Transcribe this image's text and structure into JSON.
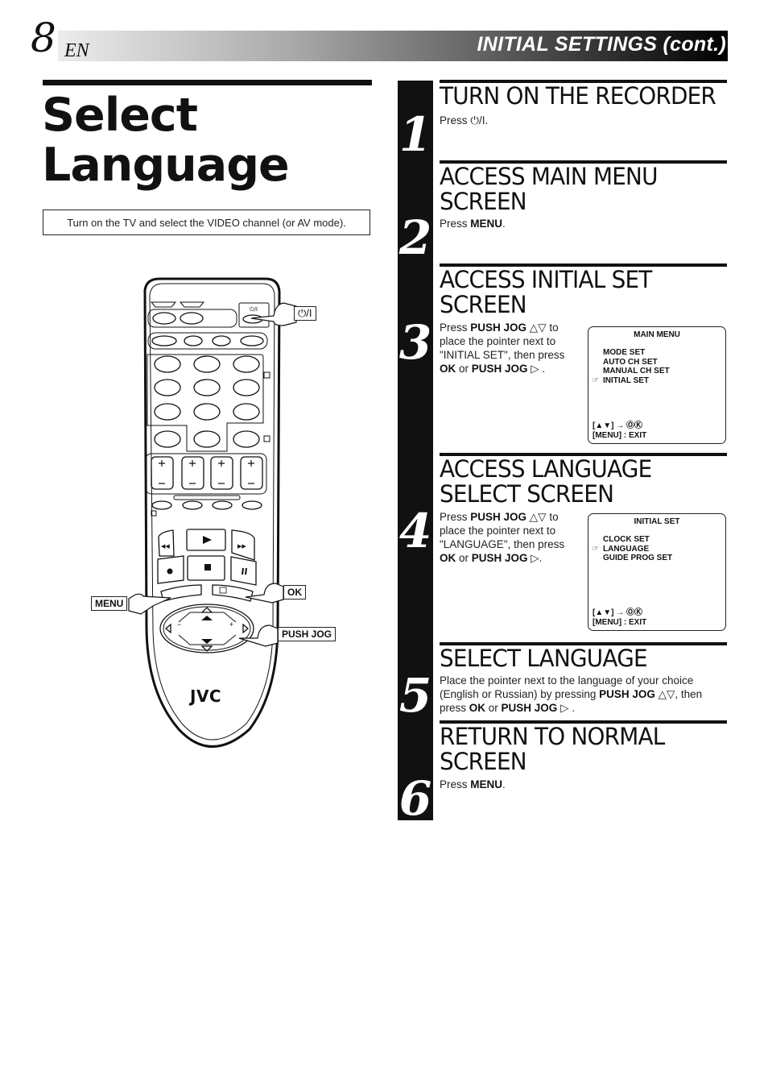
{
  "header": {
    "page_number": "8",
    "language_code": "EN",
    "section_title": "INITIAL SETTINGS (cont.)"
  },
  "page_title": {
    "line1": "Select",
    "line2": "Language"
  },
  "note": "Turn on the TV and select the VIDEO channel (or AV mode).",
  "remote": {
    "brand": "JVC",
    "callouts": {
      "power": "⏻/I",
      "menu": "MENU",
      "ok": "OK",
      "push_jog": "PUSH JOG"
    }
  },
  "steps": [
    {
      "number": "1",
      "heading": "TURN ON THE RECORDER",
      "body_prefix": "Press ",
      "body_symbol": "⏻/I",
      "body_suffix": "."
    },
    {
      "number": "2",
      "heading_line1": "ACCESS MAIN MENU",
      "heading_line2": "SCREEN",
      "body_prefix": "Press ",
      "body_key": "MENU",
      "body_suffix": "."
    },
    {
      "number": "3",
      "heading_line1": "ACCESS INITIAL SET",
      "heading_line2": "SCREEN",
      "body": {
        "press": "Press ",
        "key1": "PUSH JOG",
        "arrows": " △▽ ",
        "mid": "to place the pointer next to \"INITIAL SET\", then press ",
        "key2": "OK",
        "or": " or ",
        "key3": "PUSH JOG",
        "end": " ▷ ."
      },
      "screen": {
        "title": "MAIN MENU",
        "items": [
          "MODE SET",
          "AUTO CH SET",
          "MANUAL CH SET",
          "INITIAL SET"
        ],
        "selected_index": 3,
        "footer_line1": "[▲▼] → ⓄⓀ",
        "footer_line2": "[MENU] : EXIT"
      }
    },
    {
      "number": "4",
      "heading_line1": "ACCESS LANGUAGE",
      "heading_line2": "SELECT SCREEN",
      "body": {
        "press": "Press ",
        "key1": "PUSH JOG",
        "arrows": " △▽ ",
        "mid": "to place the pointer next to \"LANGUAGE\", then press ",
        "key2": "OK",
        "or": " or ",
        "key3": "PUSH JOG",
        "end": " ▷."
      },
      "screen": {
        "title": "INITIAL SET",
        "items": [
          "CLOCK SET",
          "LANGUAGE",
          "GUIDE PROG SET"
        ],
        "selected_index": 1,
        "footer_line1": "[▲▼] → ⓄⓀ",
        "footer_line2": "[MENU] : EXIT"
      }
    },
    {
      "number": "5",
      "heading": "SELECT LANGUAGE",
      "body": {
        "text1": "Place the pointer next to the language of your choice (English or Russian) by pressing ",
        "key1": "PUSH JOG",
        "arrows": " △▽",
        "text2": ", then press ",
        "key2": "OK",
        "or": " or ",
        "key3": "PUSH JOG",
        "end": " ▷ ."
      }
    },
    {
      "number": "6",
      "heading_line1": "RETURN TO NORMAL",
      "heading_line2": "SCREEN",
      "body_prefix": "Press ",
      "body_key": "MENU",
      "body_suffix": "."
    }
  ],
  "osd_pointer_icon": "☞"
}
